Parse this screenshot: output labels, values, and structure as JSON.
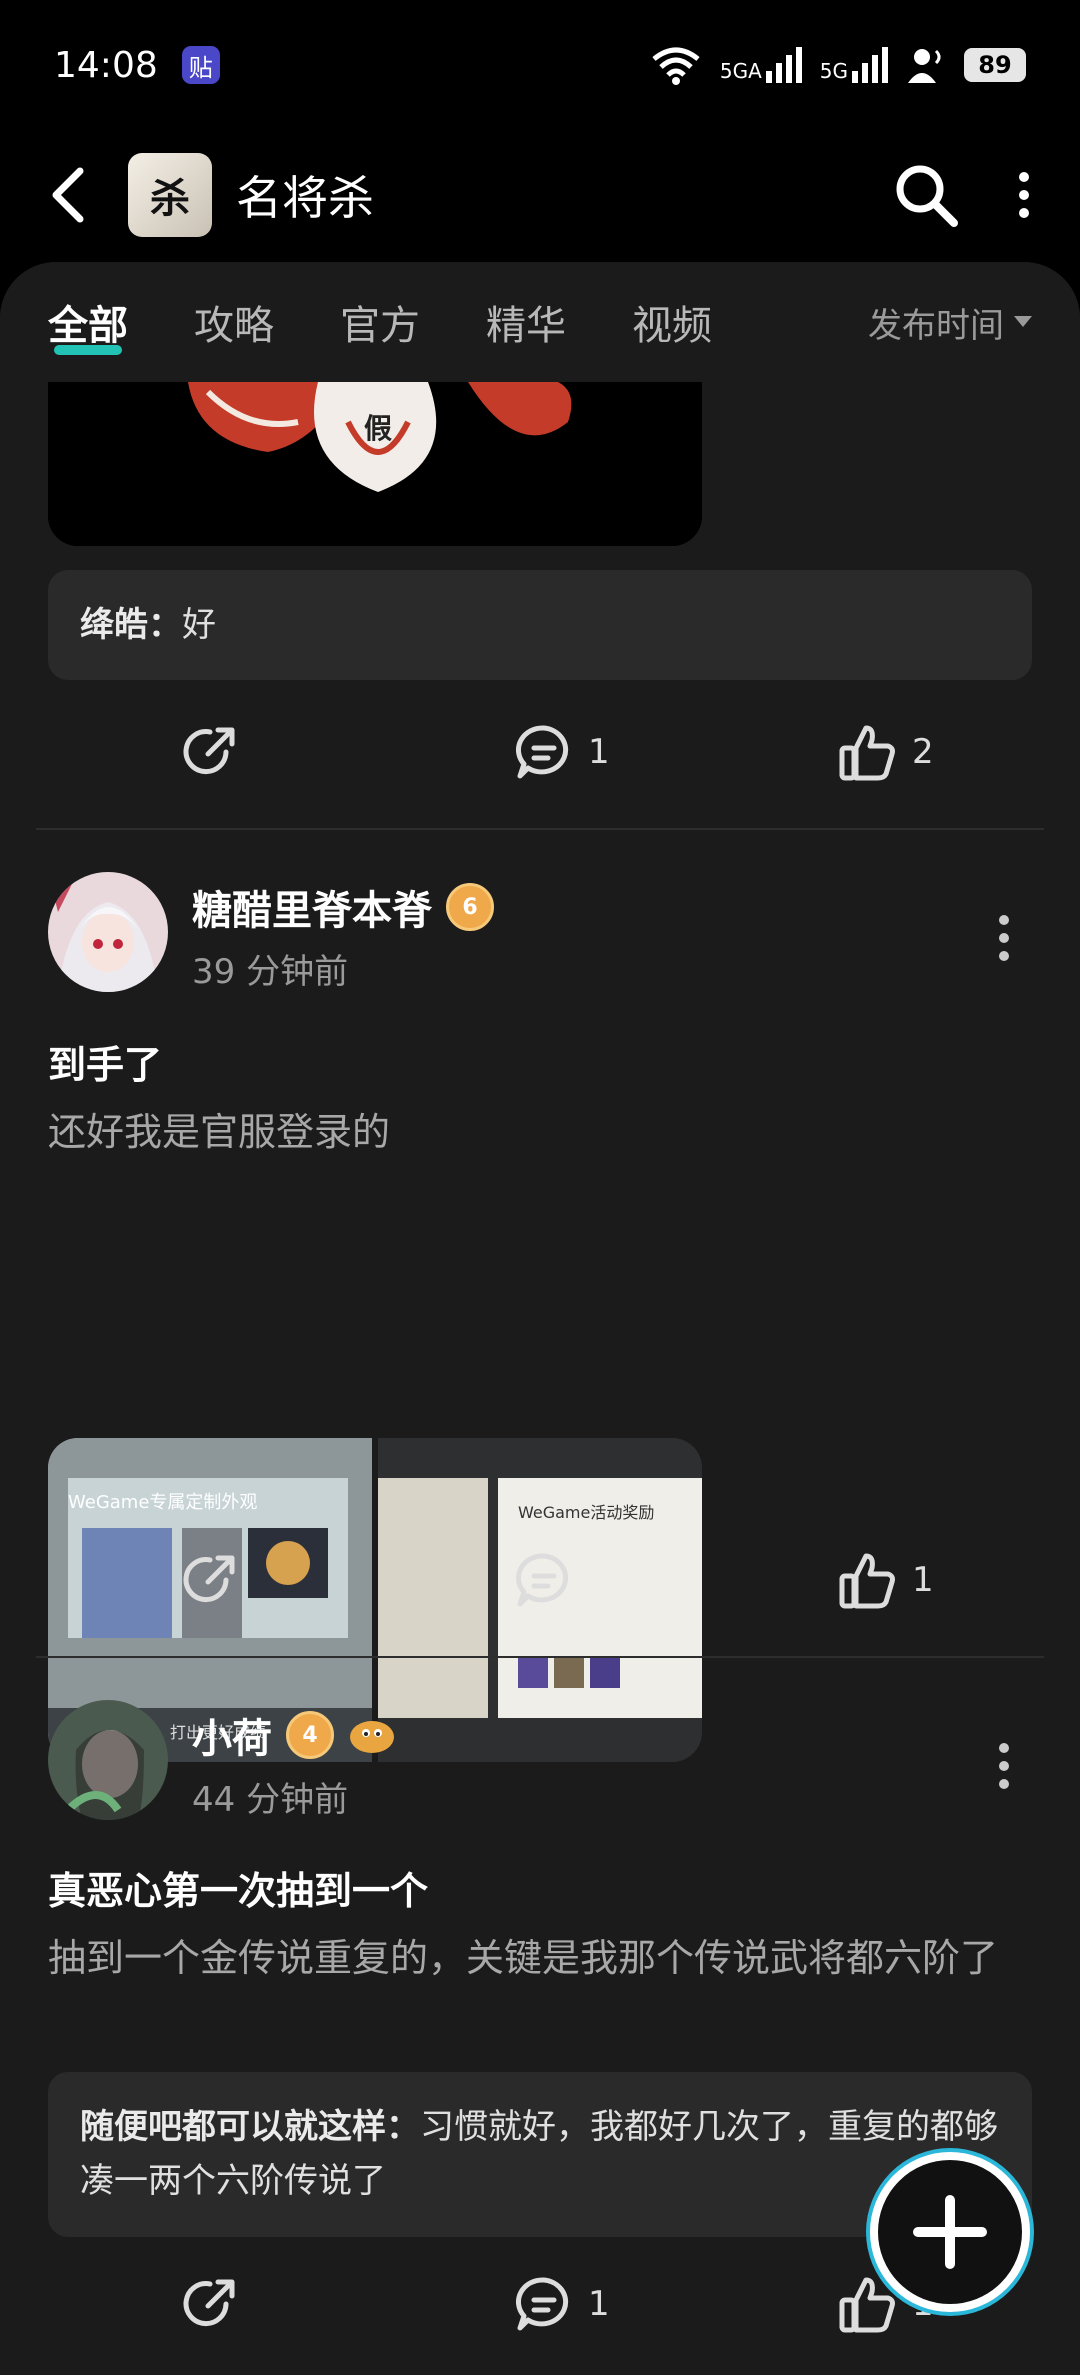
{
  "status_bar": {
    "time": "14:08",
    "app_badge": "贴",
    "signal1": "5GA",
    "signal2": "5G",
    "battery": "89"
  },
  "header": {
    "app_name": "名将杀",
    "app_icon_text": "杀"
  },
  "tabs": [
    {
      "label": "全部",
      "active": true
    },
    {
      "label": "攻略",
      "active": false
    },
    {
      "label": "官方",
      "active": false
    },
    {
      "label": "精华",
      "active": false
    },
    {
      "label": "视频",
      "active": false
    }
  ],
  "sort": {
    "label": "发布时间"
  },
  "post0": {
    "image_text": "假",
    "comment": {
      "author": "绛皓：",
      "text": "好"
    },
    "actions": {
      "comments": "1",
      "likes": "2"
    }
  },
  "post1": {
    "author": "糖醋里脊本脊",
    "level": "6",
    "time": "39 分钟前",
    "title": "到手了",
    "body": "还好我是官服登录的",
    "images": [
      {
        "caption": "WeGame专属定制外观",
        "footer": "参与活动福利，打出更好成绩"
      },
      {
        "caption": "WeGame活动奖励"
      }
    ],
    "actions": {
      "comments": "",
      "likes": "1"
    }
  },
  "post2": {
    "author": "小荷",
    "level": "4",
    "time": "44 分钟前",
    "title": "真恶心第一次抽到一个",
    "body": "抽到一个金传说重复的，关键是我那个传说武将都六阶了",
    "comment": {
      "author": "随便吧都可以就这样：",
      "text": "习惯就好，我都好几次了，重复的都够凑一两个六阶传说了"
    },
    "actions": {
      "comments": "1",
      "likes": "1"
    }
  },
  "colors": {
    "accent": "#22c3b4",
    "badge": "#f0a94a"
  }
}
